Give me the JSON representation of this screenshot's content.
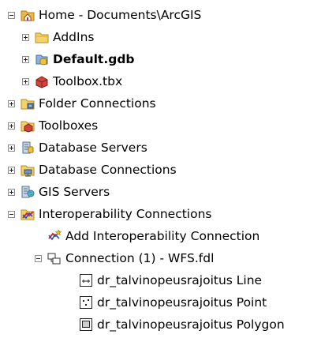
{
  "tree": {
    "items": [
      {
        "label": "Home - Documents\\ArcGIS",
        "icon": "home-folder-icon",
        "expand": "minus"
      },
      {
        "label": "AddIns",
        "icon": "folder-icon",
        "expand": "plus"
      },
      {
        "label": "Default.gdb",
        "icon": "geodatabase-icon",
        "expand": "plus",
        "bold": true
      },
      {
        "label": "Toolbox.tbx",
        "icon": "toolbox-icon",
        "expand": "plus"
      },
      {
        "label": "Folder Connections",
        "icon": "folder-connection-icon",
        "expand": "plus"
      },
      {
        "label": "Toolboxes",
        "icon": "toolbox-icon",
        "expand": "plus"
      },
      {
        "label": "Database Servers",
        "icon": "database-server-icon",
        "expand": "plus"
      },
      {
        "label": "Database Connections",
        "icon": "database-connection-icon",
        "expand": "plus"
      },
      {
        "label": "GIS Servers",
        "icon": "gis-server-icon",
        "expand": "plus"
      },
      {
        "label": "Interoperability Connections",
        "icon": "interoperability-icon",
        "expand": "minus"
      },
      {
        "label": "Add Interoperability Connection",
        "icon": "add-interop-connection-icon",
        "expand": "none"
      },
      {
        "label": "Connection (1) -  WFS.fdl",
        "icon": "interop-connection-icon",
        "expand": "minus"
      },
      {
        "label": "dr_talvinopeusrajoitus Line",
        "icon": "line-feature-class-icon",
        "expand": "none"
      },
      {
        "label": "dr_talvinopeusrajoitus Point",
        "icon": "point-feature-class-icon",
        "expand": "none"
      },
      {
        "label": "dr_talvinopeusrajoitus Polygon",
        "icon": "polygon-feature-class-icon",
        "expand": "none"
      }
    ]
  }
}
